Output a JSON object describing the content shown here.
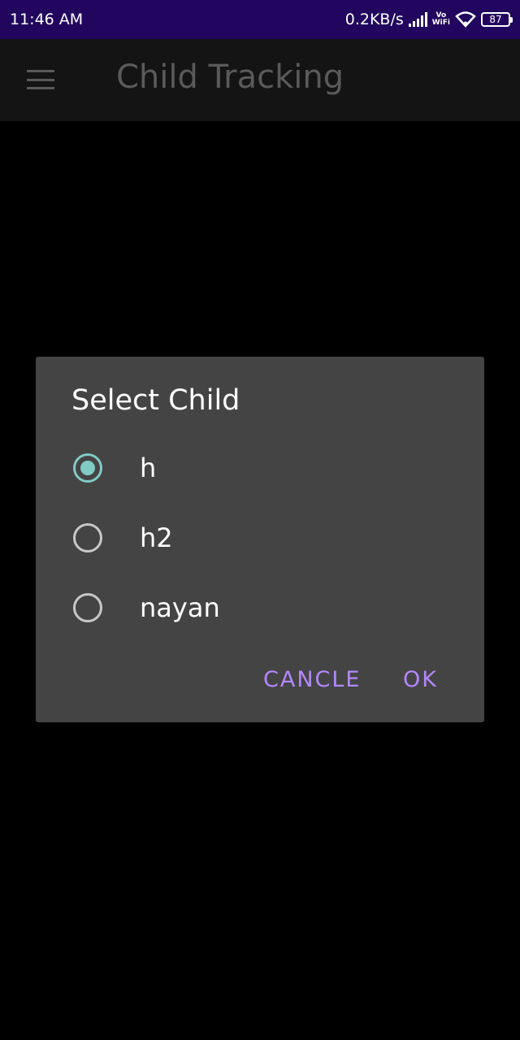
{
  "status_bar": {
    "time": "11:46 AM",
    "network_speed": "0.2KB/s",
    "vowifi_top": "Vo",
    "vowifi_bottom": "WiFi",
    "battery": "87",
    "background": "#21055e"
  },
  "app_bar": {
    "title": "Child Tracking",
    "menu_icon": "hamburger-menu-icon"
  },
  "dialog": {
    "title": "Select Child",
    "options": [
      {
        "label": "h",
        "checked": true
      },
      {
        "label": "h2",
        "checked": false
      },
      {
        "label": "nayan",
        "checked": false
      }
    ],
    "cancel_label": "CANCLE",
    "ok_label": "OK",
    "accent_color": "#b388ff",
    "radio_checked_color": "#80cbc4"
  }
}
